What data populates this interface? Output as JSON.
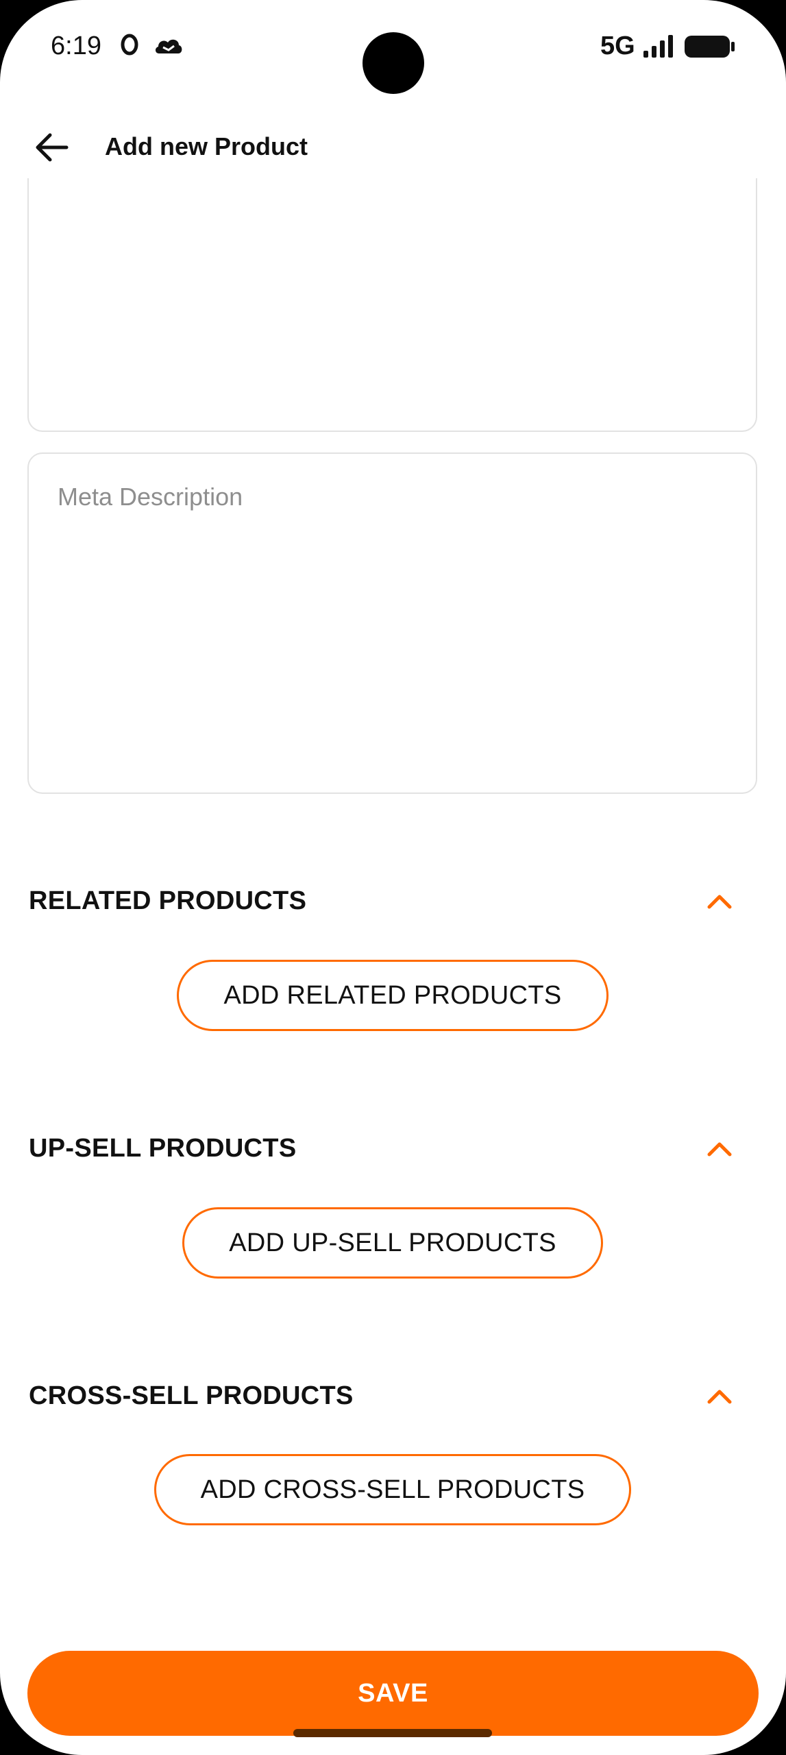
{
  "status_bar": {
    "time": "6:19",
    "network": "5G",
    "icons": [
      "o-notification-icon",
      "cloud-icon",
      "signal-icon",
      "battery-icon"
    ]
  },
  "app_bar": {
    "title": "Add new Product",
    "back_icon": "arrow-left-icon"
  },
  "meta_description": {
    "placeholder": "Meta Description",
    "value": ""
  },
  "sections": [
    {
      "title": "RELATED PRODUCTS",
      "button_label": "ADD RELATED PRODUCTS"
    },
    {
      "title": "UP-SELL PRODUCTS",
      "button_label": "ADD UP-SELL PRODUCTS"
    },
    {
      "title": "CROSS-SELL PRODUCTS",
      "button_label": "ADD CROSS-SELL PRODUCTS"
    }
  ],
  "save_label": "SAVE",
  "colors": {
    "accent": "#ff6a00",
    "text": "#111111",
    "border": "#e2e2e2",
    "placeholder": "#8e8e8e"
  }
}
